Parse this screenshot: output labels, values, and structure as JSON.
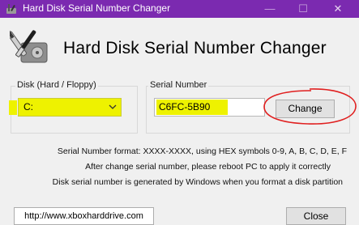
{
  "window": {
    "title": "Hard Disk Serial Number Changer",
    "controls": {
      "minimize": "—",
      "maximize": "☐",
      "close": "✕"
    }
  },
  "header": {
    "title": "Hard Disk Serial Number Changer",
    "icon": "wrench-screwdriver-disk-icon"
  },
  "disk_group": {
    "label": "Disk (Hard / Floppy)",
    "selected": "C:"
  },
  "serial_group": {
    "label": "Serial Number",
    "value": "C6FC-5B90",
    "change_label": "Change"
  },
  "info": {
    "line1": "Serial Number format: XXXX-XXXX, using HEX symbols 0-9, A, B, C, D, E, F",
    "line2": "After change serial number, please reboot PC to apply it correctly",
    "line3": "Disk serial number is generated by Windows when you format a disk partition"
  },
  "footer": {
    "url": "http://www.xboxharddrive.com",
    "close_label": "Close"
  },
  "colors": {
    "titlebar": "#7b2ab0",
    "highlight": "#eef200",
    "annotation": "#e02020"
  }
}
